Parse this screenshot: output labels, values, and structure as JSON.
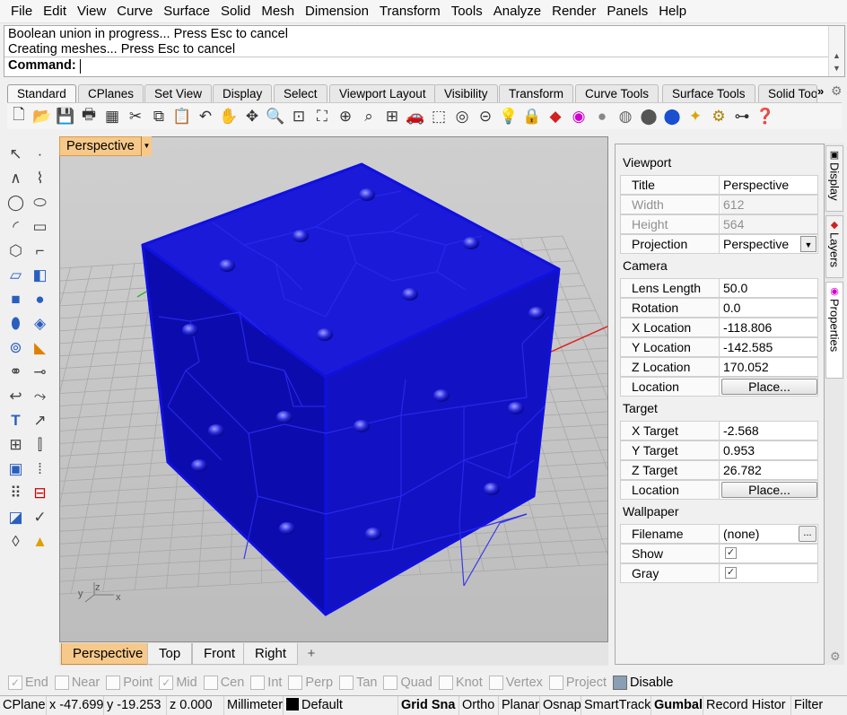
{
  "menu": [
    "File",
    "Edit",
    "View",
    "Curve",
    "Surface",
    "Solid",
    "Mesh",
    "Dimension",
    "Transform",
    "Tools",
    "Analyze",
    "Render",
    "Panels",
    "Help"
  ],
  "command": {
    "history": [
      "Boolean union in progress... Press Esc to cancel",
      "Creating meshes... Press Esc to cancel"
    ],
    "prompt": "Command:"
  },
  "toolbar_tabs": {
    "items": [
      "Standard",
      "CPlanes",
      "Set View",
      "Display",
      "Select",
      "Viewport Layout",
      "Visibility",
      "Transform",
      "Curve Tools",
      "Surface Tools",
      "Solid Too"
    ],
    "active": "Standard",
    "more": "»"
  },
  "viewport": {
    "title": "Perspective",
    "tabs": [
      "Perspective",
      "Top",
      "Front",
      "Right"
    ],
    "active_tab": "Perspective",
    "add_tab": "+",
    "model_color": "#1010e0",
    "axis_labels": {
      "x": "x",
      "y": "y",
      "z": "z"
    }
  },
  "properties": {
    "sections": {
      "viewport": "Viewport",
      "camera": "Camera",
      "target": "Target",
      "wallpaper": "Wallpaper"
    },
    "rows": {
      "title": {
        "label": "Title",
        "value": "Perspective"
      },
      "width": {
        "label": "Width",
        "value": "612"
      },
      "height": {
        "label": "Height",
        "value": "564"
      },
      "projection": {
        "label": "Projection",
        "value": "Perspective"
      },
      "lens_length": {
        "label": "Lens Length",
        "value": "50.0"
      },
      "rotation": {
        "label": "Rotation",
        "value": "0.0"
      },
      "x_location": {
        "label": "X Location",
        "value": "-118.806"
      },
      "y_location": {
        "label": "Y Location",
        "value": "-142.585"
      },
      "z_location": {
        "label": "Z Location",
        "value": "170.052"
      },
      "camera_location": {
        "label": "Location",
        "button": "Place..."
      },
      "x_target": {
        "label": "X Target",
        "value": "-2.568"
      },
      "y_target": {
        "label": "Y Target",
        "value": "0.953"
      },
      "z_target": {
        "label": "Z Target",
        "value": "26.782"
      },
      "target_location": {
        "label": "Location",
        "button": "Place..."
      },
      "filename": {
        "label": "Filename",
        "value": "(none)",
        "button": "..."
      },
      "show": {
        "label": "Show",
        "checked": true
      },
      "gray": {
        "label": "Gray",
        "checked": true
      }
    }
  },
  "side_tabs": [
    "Display",
    "Layers",
    "Properties"
  ],
  "osnaps": [
    {
      "label": "End",
      "checked": true
    },
    {
      "label": "Near",
      "checked": false
    },
    {
      "label": "Point",
      "checked": false
    },
    {
      "label": "Mid",
      "checked": true
    },
    {
      "label": "Cen",
      "checked": false
    },
    {
      "label": "Int",
      "checked": false
    },
    {
      "label": "Perp",
      "checked": false
    },
    {
      "label": "Tan",
      "checked": false
    },
    {
      "label": "Quad",
      "checked": false
    },
    {
      "label": "Knot",
      "checked": false
    },
    {
      "label": "Vertex",
      "checked": false
    },
    {
      "label": "Project",
      "checked": false
    },
    {
      "label": "Disable",
      "checked": true
    }
  ],
  "status": {
    "cplane": "CPlane",
    "x": "x -47.699",
    "y": "y -19.253",
    "z": "z 0.000",
    "units": "Millimeter",
    "layer": "Default",
    "grid_snap": "Grid Sna",
    "ortho": "Ortho",
    "planar": "Planar",
    "osnap": "Osnap",
    "smarttrack": "SmartTrack",
    "gumball": "Gumbal",
    "record_history": "Record Histor",
    "filter": "Filter"
  }
}
